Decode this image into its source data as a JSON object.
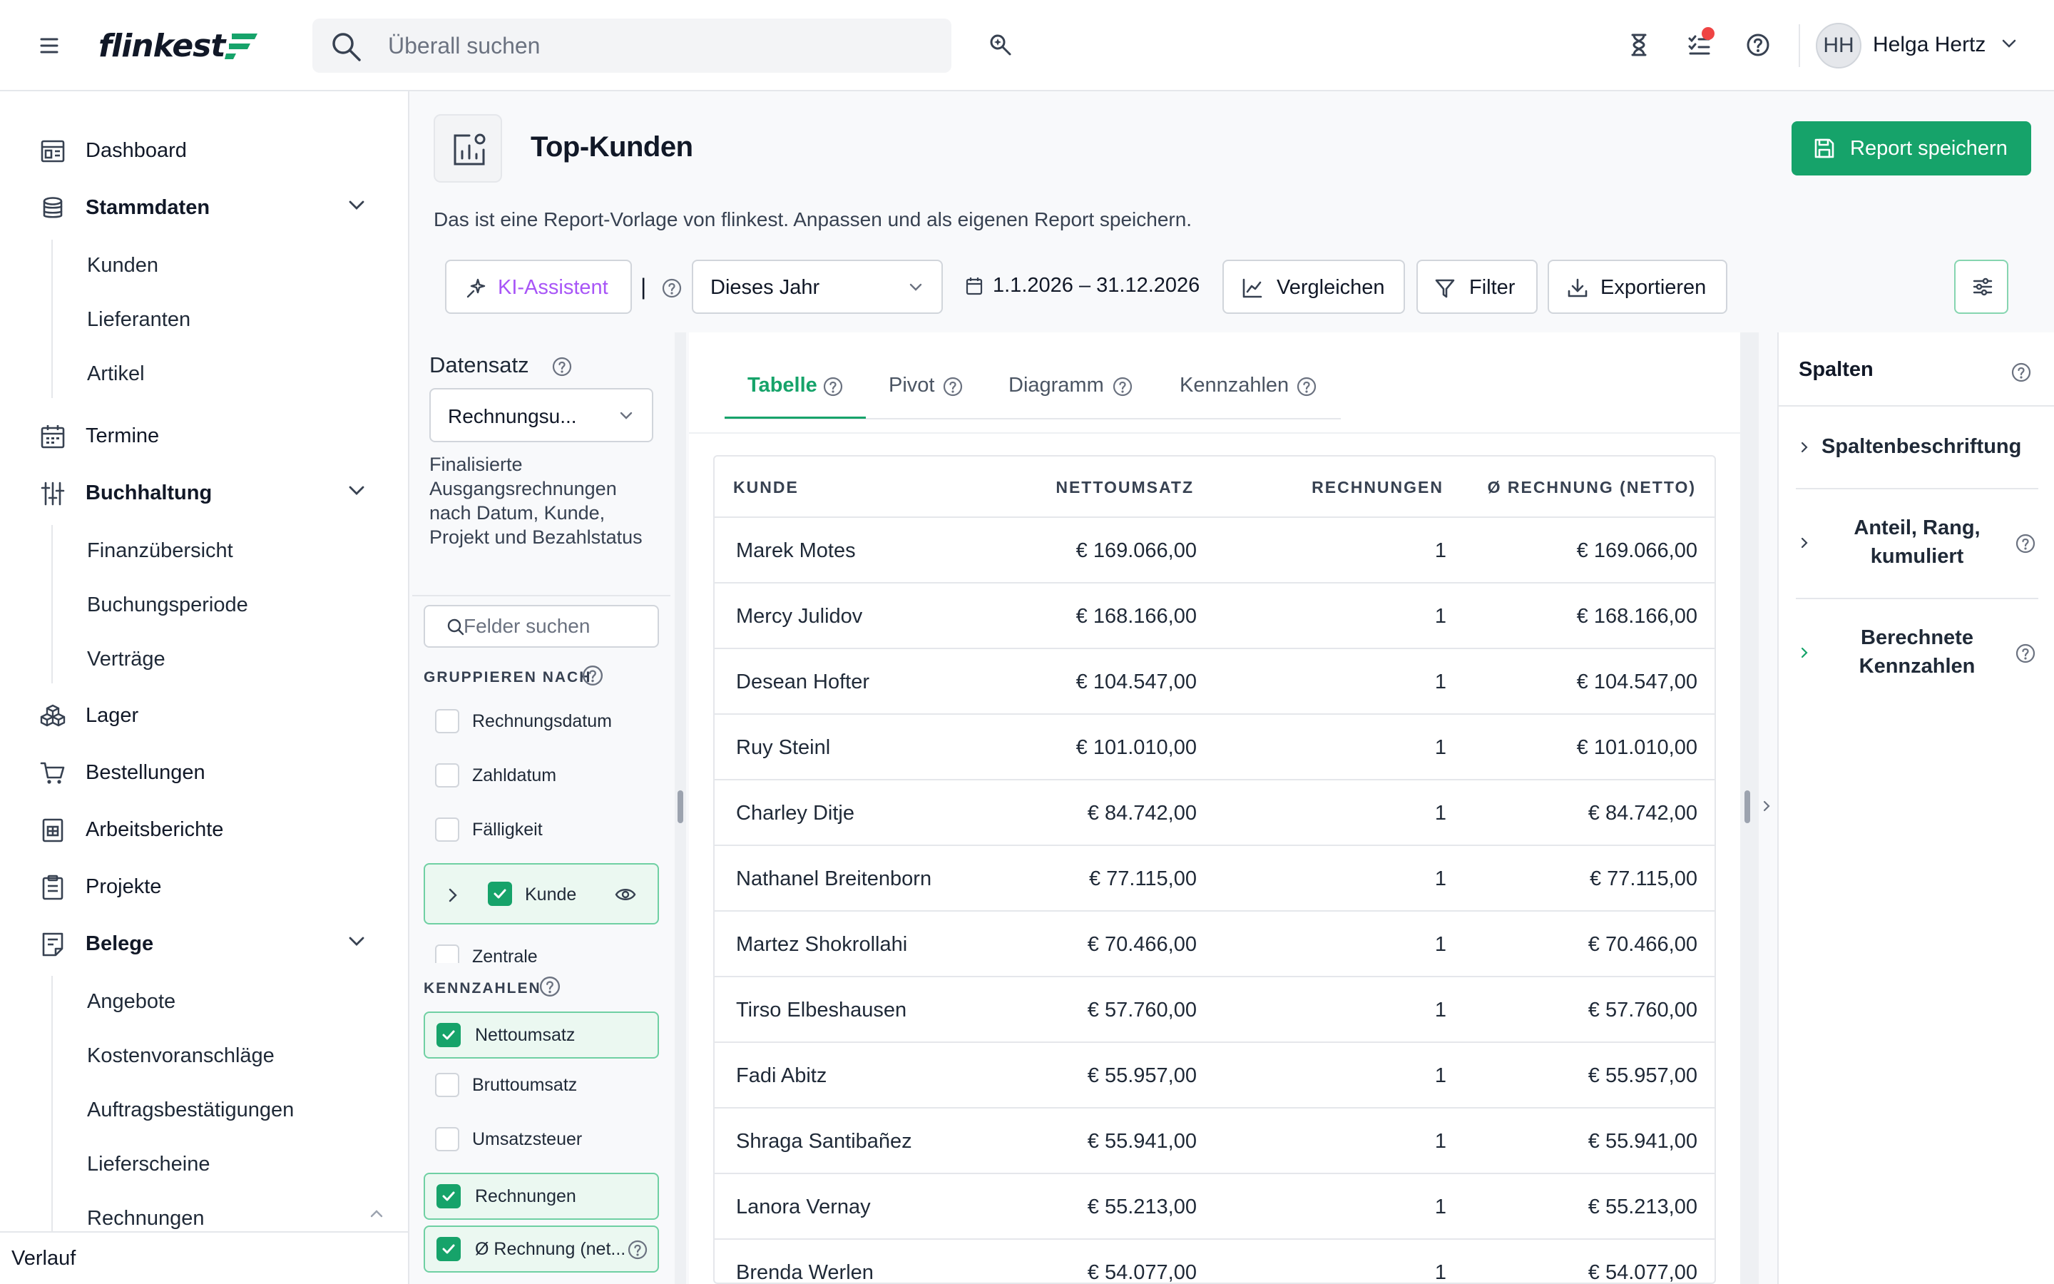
{
  "app": {
    "logo_text": "flinkest"
  },
  "colors": {
    "accent": "#16a36a",
    "ki": "#a855f7",
    "notification": "#ef4444"
  },
  "search": {
    "placeholder": "Überall suchen"
  },
  "user": {
    "initials": "HH",
    "name": "Helga Hertz"
  },
  "sidebar": {
    "items": [
      {
        "label": "Dashboard",
        "icon": "dashboard-icon"
      },
      {
        "label": "Stammdaten",
        "icon": "database-icon",
        "expanded": true,
        "children": [
          "Kunden",
          "Lieferanten",
          "Artikel"
        ]
      },
      {
        "label": "Termine",
        "icon": "calendar-icon"
      },
      {
        "label": "Buchhaltung",
        "icon": "sliders-icon",
        "expanded": true,
        "children": [
          "Finanzübersicht",
          "Buchungsperiode",
          "Verträge"
        ]
      },
      {
        "label": "Lager",
        "icon": "boxes-icon"
      },
      {
        "label": "Bestellungen",
        "icon": "cart-icon"
      },
      {
        "label": "Arbeitsberichte",
        "icon": "worksheet-icon"
      },
      {
        "label": "Projekte",
        "icon": "clipboard-icon"
      },
      {
        "label": "Belege",
        "icon": "receipt-icon",
        "expanded": true,
        "children": [
          "Angebote",
          "Kostenvoranschläge",
          "Auftragsbestätigungen",
          "Lieferscheine",
          "Rechnungen"
        ]
      }
    ],
    "footer": "Verlauf"
  },
  "report": {
    "title": "Top-Kunden",
    "save_label": "Report speichern",
    "description": "Das ist eine Report-Vorlage von flinkest. Anpassen und als eigenen Report speichern."
  },
  "toolbar": {
    "ki_label": "KI-Assistent",
    "separator": "|",
    "period": "Dieses Jahr",
    "date_range": "1.1.2026 – 31.12.2026",
    "compare_label": "Vergleichen",
    "filter_label": "Filter",
    "export_label": "Exportieren"
  },
  "dataset": {
    "label": "Datensatz",
    "selected": "Rechnungsu...",
    "description": "Finalisierte Ausgangsrechnungen nach Datum, Kunde, Projekt und Bezahlstatus",
    "fields_placeholder": "Felder suchen",
    "group_heading": "GRUPPIEREN NACH",
    "group_fields": [
      {
        "label": "Rechnungsdatum",
        "checked": false
      },
      {
        "label": "Zahldatum",
        "checked": false
      },
      {
        "label": "Fälligkeit",
        "checked": false
      },
      {
        "label": "Kunde",
        "checked": true
      },
      {
        "label": "Zentrale",
        "checked": false
      }
    ],
    "metrics_heading": "KENNZAHLEN",
    "metric_fields": [
      {
        "label": "Nettoumsatz",
        "checked": true
      },
      {
        "label": "Bruttoumsatz",
        "checked": false
      },
      {
        "label": "Umsatzsteuer",
        "checked": false
      },
      {
        "label": "Rechnungen",
        "checked": true
      },
      {
        "label": "Ø Rechnung (net...",
        "checked": true
      }
    ]
  },
  "tabs": [
    "Tabelle",
    "Pivot",
    "Diagramm",
    "Kennzahlen"
  ],
  "active_tab": "Tabelle",
  "table": {
    "headers": [
      "KUNDE",
      "NETTOUMSATZ",
      "RECHNUNGEN",
      "Ø RECHNUNG (NETTO)"
    ],
    "rows": [
      [
        "Marek Motes",
        "€ 169.066,00",
        "1",
        "€ 169.066,00"
      ],
      [
        "Mercy Julidov",
        "€ 168.166,00",
        "1",
        "€ 168.166,00"
      ],
      [
        "Desean Hofter",
        "€ 104.547,00",
        "1",
        "€ 104.547,00"
      ],
      [
        "Ruy Steinl",
        "€ 101.010,00",
        "1",
        "€ 101.010,00"
      ],
      [
        "Charley Ditje",
        "€ 84.742,00",
        "1",
        "€ 84.742,00"
      ],
      [
        "Nathanel Breitenborn",
        "€ 77.115,00",
        "1",
        "€ 77.115,00"
      ],
      [
        "Martez Shokrollahi",
        "€ 70.466,00",
        "1",
        "€ 70.466,00"
      ],
      [
        "Tirso Elbeshausen",
        "€ 57.760,00",
        "1",
        "€ 57.760,00"
      ],
      [
        "Fadi Abitz",
        "€ 55.957,00",
        "1",
        "€ 55.957,00"
      ],
      [
        "Shraga Santibañez",
        "€ 55.941,00",
        "1",
        "€ 55.941,00"
      ],
      [
        "Lanora Vernay",
        "€ 55.213,00",
        "1",
        "€ 55.213,00"
      ],
      [
        "Brenda Werlen",
        "€ 54.077,00",
        "1",
        "€ 54.077,00"
      ]
    ]
  },
  "columns_panel": {
    "title": "Spalten",
    "sections": [
      "Spaltenbeschriftung",
      "Anteil, Rang, kumuliert",
      "Berechnete Kennzahlen"
    ]
  }
}
